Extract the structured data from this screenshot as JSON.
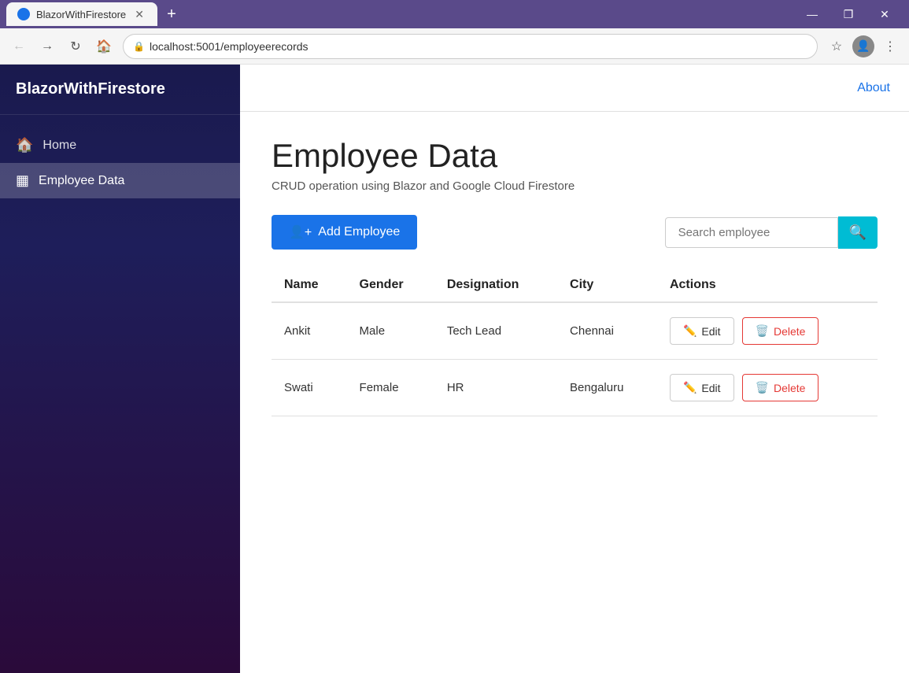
{
  "browser": {
    "tab_title": "BlazorWithFirestore",
    "new_tab_symbol": "+",
    "address": "localhost:5001/employeerecords",
    "window_controls": {
      "minimize": "—",
      "maximize": "❐",
      "close": "✕"
    }
  },
  "sidebar": {
    "brand": "BlazorWithFirestore",
    "items": [
      {
        "id": "home",
        "label": "Home",
        "icon": "🏠",
        "active": false
      },
      {
        "id": "employee-data",
        "label": "Employee Data",
        "icon": "▦",
        "active": true
      }
    ]
  },
  "topnav": {
    "about_label": "About"
  },
  "content": {
    "page_title": "Employee Data",
    "page_subtitle": "CRUD operation using Blazor and Google Cloud Firestore",
    "add_button_label": "Add Employee",
    "search_placeholder": "Search employee",
    "table": {
      "headers": [
        "Name",
        "Gender",
        "Designation",
        "City",
        "Actions"
      ],
      "rows": [
        {
          "name": "Ankit",
          "gender": "Male",
          "designation": "Tech Lead",
          "city": "Chennai"
        },
        {
          "name": "Swati",
          "gender": "Female",
          "designation": "HR",
          "city": "Bengaluru"
        }
      ],
      "edit_label": "Edit",
      "delete_label": "Delete"
    }
  }
}
